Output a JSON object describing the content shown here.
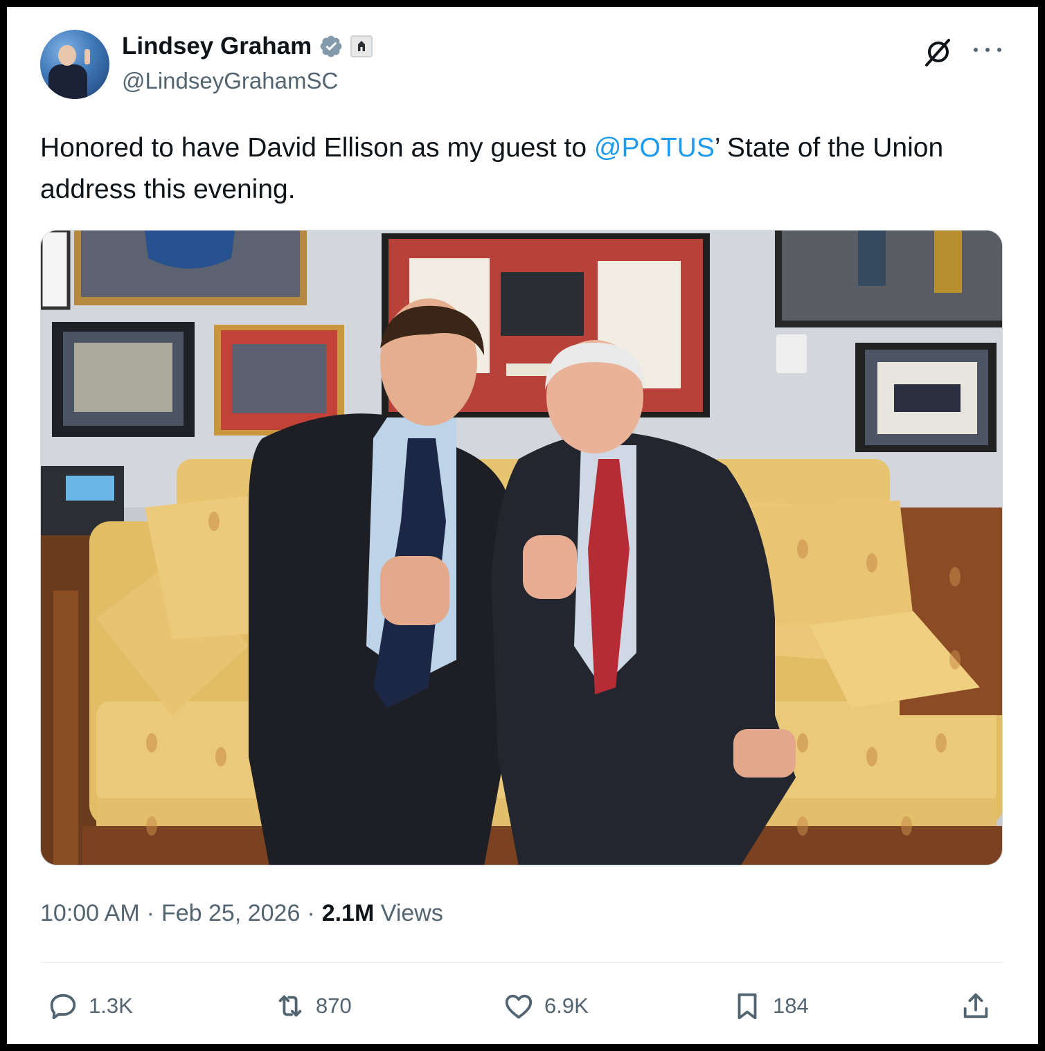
{
  "post": {
    "author_name": "Lindsey Graham",
    "author_handle": "@LindseyGrahamSC",
    "text_before": "Honored to have David Ellison as my guest to ",
    "mention": "@POTUS",
    "text_after": "’ State of the Union address this evening.",
    "time": "10:00 AM",
    "separator": "·",
    "date": "Feb 25, 2026",
    "views_count": "2.1M",
    "views_label": "Views"
  },
  "actions": {
    "replies": "1.3K",
    "reposts": "870",
    "likes": "6.9K",
    "bookmarks": "184"
  },
  "icons": {
    "verified": "verified-badge-icon",
    "government": "government-affiliation-icon",
    "grok": "grok-icon",
    "more": "more-icon",
    "reply": "reply-icon",
    "repost": "repost-icon",
    "like": "like-icon",
    "bookmark": "bookmark-icon",
    "share": "share-icon"
  },
  "colors": {
    "accent": "#1d9bf0",
    "text": "#0f1419",
    "secondary": "#536471",
    "verified_badge": "#829aab"
  }
}
